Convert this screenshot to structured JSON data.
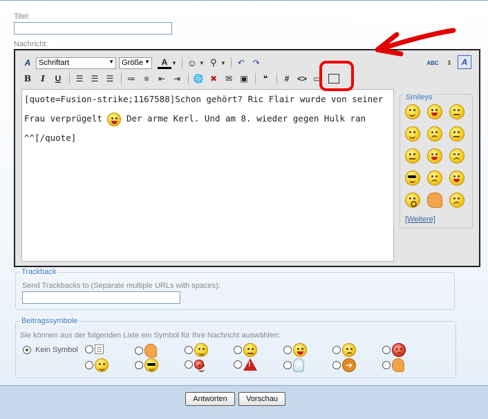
{
  "form": {
    "title_label": "Titel:",
    "title_value": "",
    "message_label": "Nachricht:"
  },
  "toolbar": {
    "font_select": "Schriftart",
    "size_select": "Größe",
    "font_color_glyph": "A",
    "bold": "B",
    "italic": "I",
    "underline": "U",
    "hash_glyph": "#",
    "code_glyph": "<>",
    "spellcheck_glyph": "ABC"
  },
  "editor": {
    "content_part1": "[quote=Fusion-strike;1167588]Schon gehört? Ric Flair wurde von seiner Frau verprügelt",
    "content_part2": "Der arme Kerl. Und am 8. wieder gegen Hulk ran ^^[/quote]"
  },
  "smilies": {
    "title": "Smileys",
    "more_link": "[Weitere]"
  },
  "trackback": {
    "title": "Trackback",
    "hint": "Send Trackbacks to (Separate multiple URLs with spaces):",
    "value": ""
  },
  "post_icons": {
    "title": "Beitragssymbole",
    "hint": "Sie können aus der folgenden Liste ein Symbol für Ihre Nachricht auswählen:",
    "none_label": "Kein Symbol"
  },
  "buttons": {
    "submit": "Antworten",
    "preview": "Vorschau"
  },
  "colors": {
    "annotation_red": "#e00000",
    "link_blue": "#3a78c2"
  }
}
